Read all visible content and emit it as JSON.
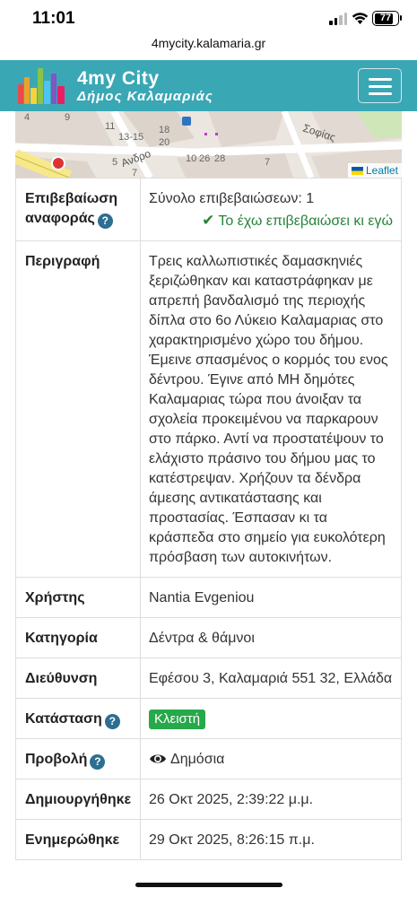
{
  "status_bar": {
    "time": "11:01",
    "battery": "77"
  },
  "browser": {
    "url": "4mycity.kalamaria.gr"
  },
  "header": {
    "brand_line1": "4my City",
    "brand_line2": "Δήμος Καλαμαριάς",
    "menu_icon": "hamburger-icon"
  },
  "map": {
    "attribution": "Leaflet",
    "street_1": "Σοφίας",
    "street_2": "Ανδρο",
    "numbers": [
      "4",
      "9",
      "11",
      "13-15",
      "18",
      "20",
      "5",
      "7",
      "10",
      "26",
      "28",
      "7"
    ]
  },
  "details": {
    "confirmation": {
      "label": "Επιβεβαίωση αναφοράς",
      "total": "Σύνολο επιβεβαιώσεων: 1",
      "confirmed_by_me": "Το έχω επιβεβαιώσει κι εγώ"
    },
    "description": {
      "label": "Περιγραφή",
      "text": "Τρεις καλλωπιστικές δαμασκηνιές ξεριζώθηκαν και καταστράφηκαν με απρεπή βανδαλισμό της περιοχής δίπλα στο 6ο Λύκειο Καλαμαριας στο χαρακτηρισμένο χώρο του δήμου. Έμεινε σπασμένος ο κορμός του ενος δέντρου. Έγινε από ΜΗ δημότες Καλαμαριας τώρα που άνοιξαν τα σχολεία προκειμένου να παρκαρουν στο πάρκο. Αντί να προστατέψουν το ελάχιστο πράσινο του δήμου μας το κατέστρεψαν. Χρήζουν τα δένδρα άμεσης αντικατάστασης και προστασίας. Έσπασαν κι τα κράσπεδα στο σημείο για ευκολότερη πρόσβαση των αυτοκινήτων."
    },
    "user": {
      "label": "Χρήστης",
      "value": "Nantia Evgeniou"
    },
    "category": {
      "label": "Κατηγορία",
      "value": "Δέντρα & θάμνοι"
    },
    "address": {
      "label": "Διεύθυνση",
      "value": "Εφέσου 3, Καλαμαριά 551 32, Ελλάδα"
    },
    "status": {
      "label": "Κατάσταση",
      "value": "Κλειστή",
      "color": "#27a84a"
    },
    "visibility": {
      "label": "Προβολή",
      "value": "Δημόσια"
    },
    "created": {
      "label": "Δημιουργήθηκε",
      "value": "26 Οκτ 2025, 2:39:22 μ.μ."
    },
    "updated": {
      "label": "Ενημερώθηκε",
      "value": "29 Οκτ 2025, 8:26:15 π.μ."
    }
  },
  "help_glyph": "?",
  "colors": {
    "header": "#3aa7b5",
    "help": "#2e6e92",
    "confirmed": "#27833a"
  }
}
